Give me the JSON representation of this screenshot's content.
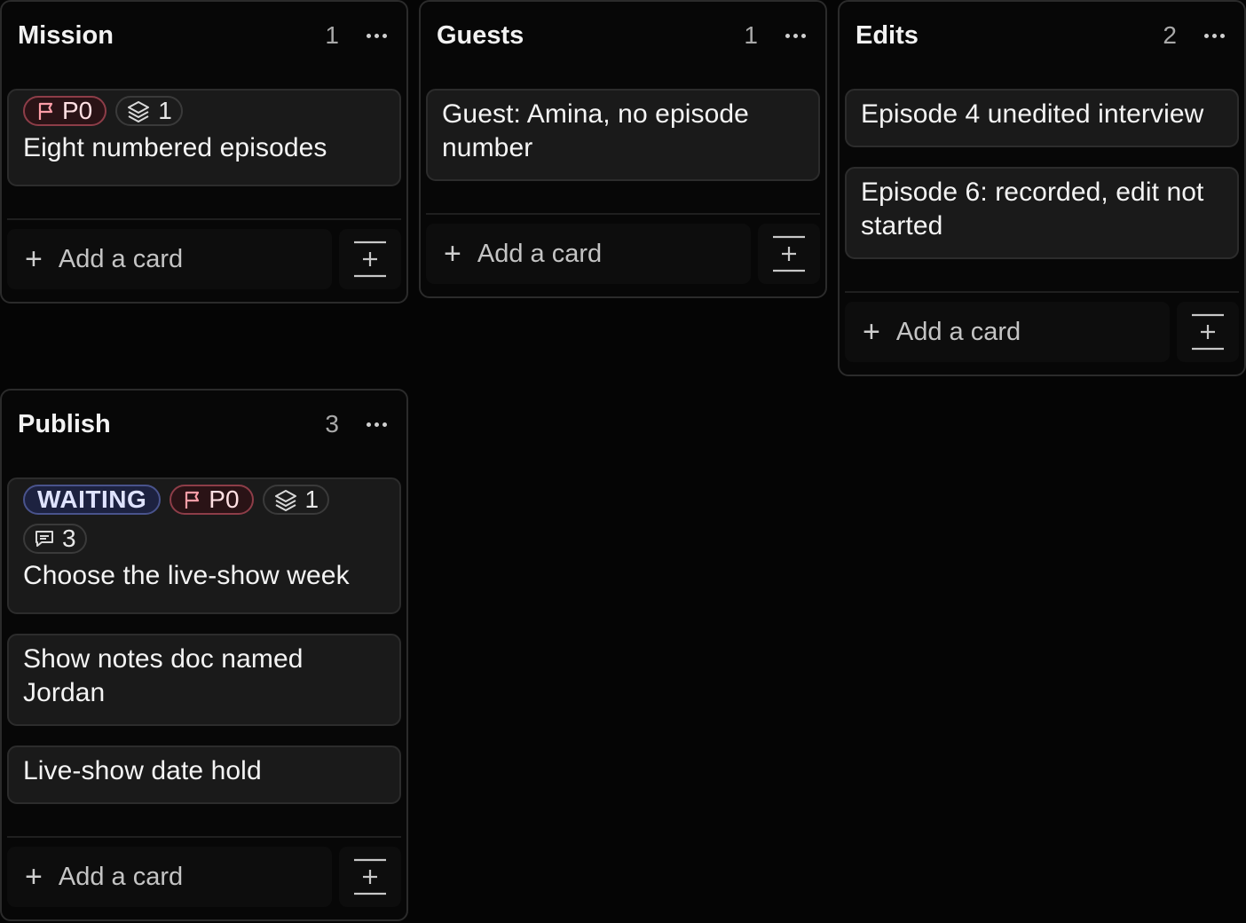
{
  "columns": [
    {
      "title": "Mission",
      "count": "1",
      "add_label": "Add a card",
      "cards": [
        {
          "title": "Eight numbered episodes",
          "priority": "P0",
          "subtasks": "1"
        }
      ]
    },
    {
      "title": "Guests",
      "count": "1",
      "add_label": "Add a card",
      "cards": [
        {
          "title": "Guest: Amina, no episode number"
        }
      ]
    },
    {
      "title": "Edits",
      "count": "2",
      "add_label": "Add a card",
      "cards": [
        {
          "title": "Episode 4 unedited interview"
        },
        {
          "title": "Episode 6: recorded, edit not started"
        }
      ]
    },
    {
      "title": "Publish",
      "count": "3",
      "add_label": "Add a card",
      "cards": [
        {
          "title": "Choose the live-show week",
          "status": "WAITING",
          "priority": "P0",
          "subtasks": "1",
          "comments": "3"
        },
        {
          "title": "Show notes doc named Jordan"
        },
        {
          "title": "Live-show date hold"
        }
      ]
    }
  ],
  "icons": {
    "priority": "flag-icon",
    "subtasks": "layers-icon",
    "comments": "comment-icon",
    "menu": "more-horizontal-icon",
    "add": "plus-icon",
    "template": "insert-template-icon"
  },
  "colors": {
    "background": "#050505",
    "card": "#1a1a1a",
    "priority_border": "#8d3d48",
    "waiting_border": "#49538c"
  }
}
